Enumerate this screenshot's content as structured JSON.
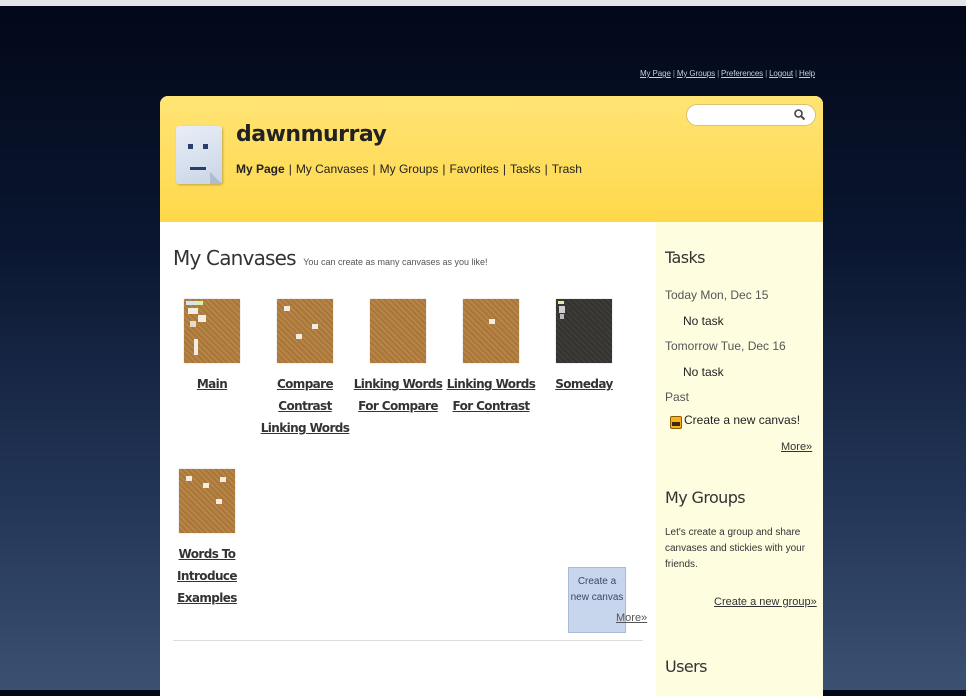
{
  "top_links": [
    "My Page",
    "My Groups",
    "Preferences",
    "Logout",
    "Help"
  ],
  "user": {
    "name": "dawnmurray"
  },
  "nav": [
    "My Page",
    "My Canvases",
    "My Groups",
    "Favorites",
    "Tasks",
    "Trash"
  ],
  "search": {
    "value": "",
    "placeholder": ""
  },
  "canvases": {
    "title": "My Canvases",
    "subtitle": "You can create as many canvases as you like!",
    "items": [
      {
        "label": "Main"
      },
      {
        "label": "Compare Contrast Linking Words"
      },
      {
        "label": "Linking Words For Compare"
      },
      {
        "label": "Linking Words For Contrast"
      },
      {
        "label": "Someday"
      },
      {
        "label": "Words To Introduce Examples"
      }
    ],
    "create_label": "Create a new canvas",
    "more": "More»"
  },
  "tasks": {
    "title": "Tasks",
    "today": "Today Mon, Dec 15",
    "today_task": "No task",
    "tomorrow": "Tomorrow Tue, Dec 16",
    "tomorrow_task": "No task",
    "past": "Past",
    "past_task": "Create a new canvas!",
    "more": "More»"
  },
  "groups": {
    "title": "My Groups",
    "text": "Let's create a group and share canvases and stickies with your friends.",
    "create_link": "Create a new group»"
  },
  "users": {
    "title": "Users"
  },
  "colors": {
    "header": "#ffd84a",
    "sidebar": "#fffde0",
    "create_box": "#c7d6ec"
  }
}
